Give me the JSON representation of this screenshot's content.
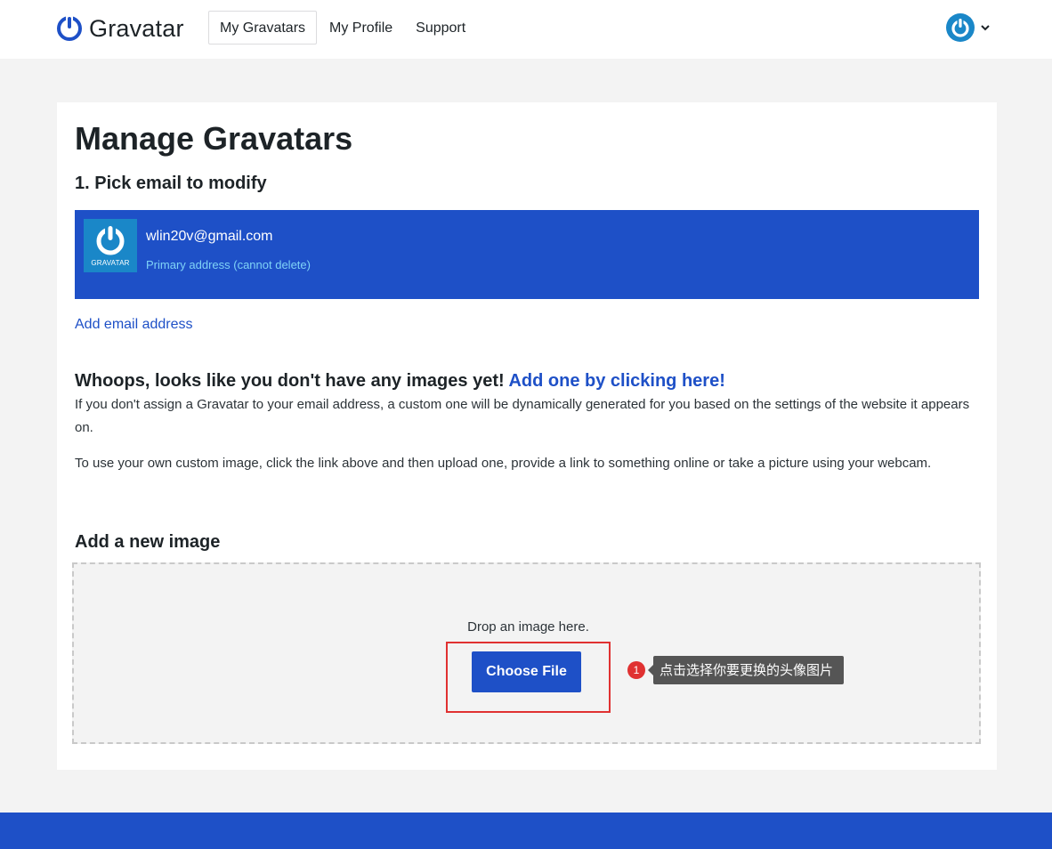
{
  "colors": {
    "brand_blue": "#1e50c7",
    "gravatar_blue": "#1a87c8",
    "highlight_red": "#e03131"
  },
  "header": {
    "brand": "Gravatar",
    "brand_icon": "gravatar-logo-icon",
    "nav": [
      {
        "label": "My Gravatars",
        "active": true
      },
      {
        "label": "My Profile",
        "active": false
      },
      {
        "label": "Support",
        "active": false
      }
    ],
    "user_icon": "user-avatar-icon"
  },
  "main": {
    "title": "Manage Gravatars",
    "pick_email_title": "1. Pick email to modify",
    "email": {
      "address": "wlin20v@gmail.com",
      "note": "Primary address (cannot delete)",
      "avatar_label": "GRAVATAR"
    },
    "add_email_link": "Add email address",
    "empty_heading": "Whoops, looks like you don't have any images yet!",
    "empty_link": "Add one by clicking here!",
    "paragraph1": "If you don't assign a Gravatar to your email address, a custom one will be dynamically generated for you based on the settings of the website it appears on.",
    "paragraph2": "To use your own custom image, click the link above and then upload one, provide a link to something online or take a picture using your webcam.",
    "add_image_title": "Add a new image",
    "drop_text": "Drop an image here.",
    "choose_file_label": "Choose File"
  },
  "annotation": {
    "step": "1",
    "tooltip": "点击选择你要更换的头像图片"
  }
}
